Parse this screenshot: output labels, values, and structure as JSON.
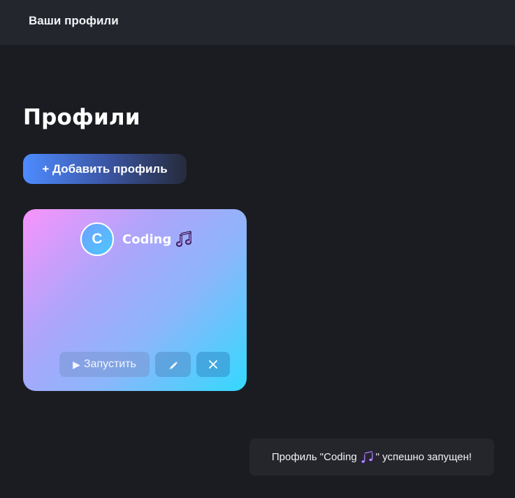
{
  "header": {
    "title": "Ваши профили"
  },
  "main": {
    "title": "Профили",
    "add_button_label": "+ Добавить профиль"
  },
  "profile": {
    "avatar_letter": "C",
    "name": "Coding",
    "name_icon": "music-note-icon",
    "launch_label": "Запустить",
    "launch_icon": "play-icon",
    "edit_icon": "pencil-icon",
    "delete_icon": "close-icon"
  },
  "toast": {
    "prefix": "Профиль \"Coding ",
    "suffix": "\" успешно запущен!",
    "icon": "music-note-icon"
  },
  "colors": {
    "background": "#1b1c21",
    "topbar": "#24262e",
    "card_gradient": [
      "#f894fb",
      "#8cb6fb",
      "#33d9fd"
    ],
    "add_button_gradient": [
      "#4e8cff",
      "#262b3b"
    ]
  }
}
